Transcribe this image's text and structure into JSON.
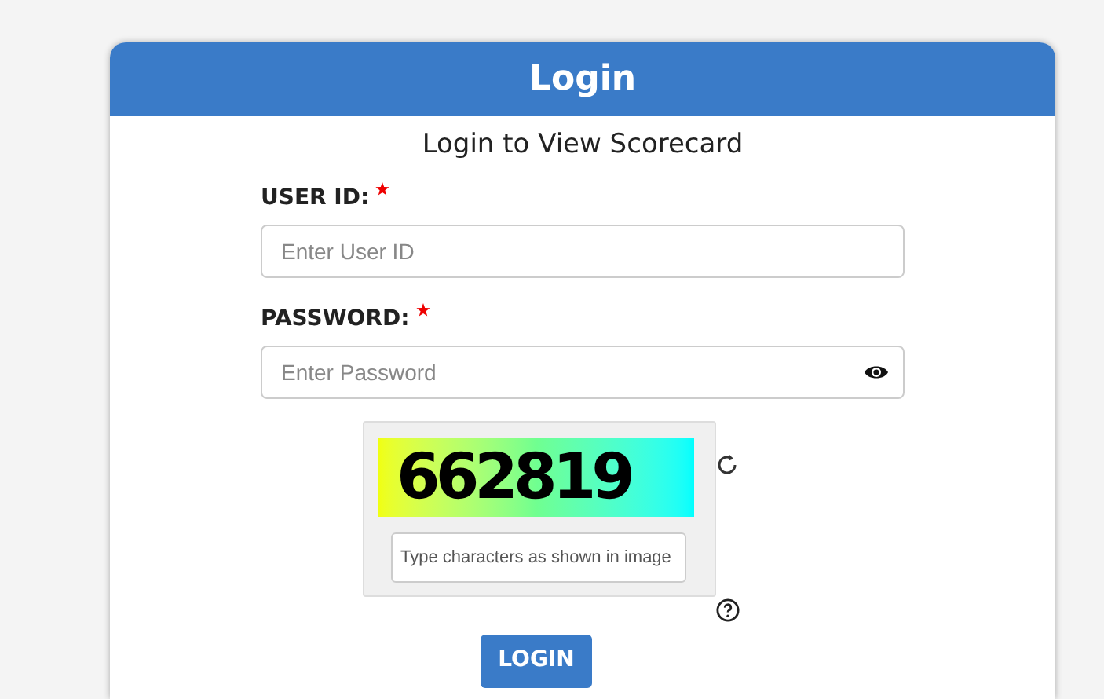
{
  "card": {
    "title": "Login",
    "subtitle": "Login to View Scorecard"
  },
  "fields": [
    {
      "label": "USER ID:",
      "required": true,
      "placeholder": "Enter User ID",
      "kind": "text"
    },
    {
      "label": "PASSWORD:",
      "required": true,
      "placeholder": "Enter Password",
      "kind": "password"
    }
  ],
  "captcha": {
    "code": "662819",
    "placeholder": "Type characters as shown in image"
  },
  "button": "LOGIN"
}
